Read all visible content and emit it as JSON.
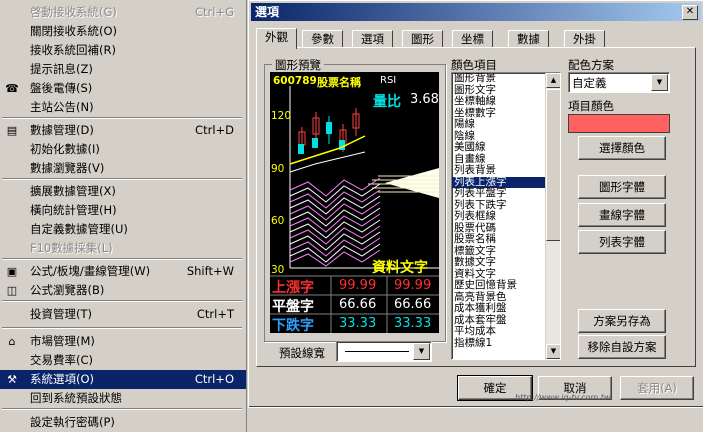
{
  "menu": {
    "items": [
      {
        "label": "啓動接收系統(G)",
        "shortcut": "Ctrl+G",
        "disabled": true,
        "icon": ""
      },
      {
        "label": "關閉接收系統(O)",
        "shortcut": "",
        "disabled": false,
        "icon": ""
      },
      {
        "label": "接收系統回補(R)",
        "shortcut": "",
        "disabled": false,
        "icon": ""
      },
      {
        "label": "提示訊息(Z)",
        "shortcut": "",
        "disabled": false,
        "icon": ""
      },
      {
        "label": "盤後電傳(S)",
        "shortcut": "",
        "disabled": false,
        "icon": "modem-icon"
      },
      {
        "label": "主站公告(N)",
        "shortcut": "",
        "disabled": false,
        "icon": ""
      },
      {
        "label": "數據管理(D)",
        "shortcut": "Ctrl+D",
        "disabled": false,
        "icon": "data-manager-icon"
      },
      {
        "label": "初始化數據(I)",
        "shortcut": "",
        "disabled": false,
        "icon": ""
      },
      {
        "label": "數據瀏覽器(V)",
        "shortcut": "",
        "disabled": false,
        "icon": ""
      },
      {
        "label": "擴展數據管理(X)",
        "shortcut": "",
        "disabled": false,
        "icon": ""
      },
      {
        "label": "橫向統計管理(H)",
        "shortcut": "",
        "disabled": false,
        "icon": ""
      },
      {
        "label": "自定義數據管理(U)",
        "shortcut": "",
        "disabled": false,
        "icon": ""
      },
      {
        "label": "F10數據採集(L)",
        "shortcut": "",
        "disabled": true,
        "icon": ""
      },
      {
        "label": "公式/板塊/畫線管理(W)",
        "shortcut": "Shift+W",
        "disabled": false,
        "icon": "formula-icon"
      },
      {
        "label": "公式瀏覽器(B)",
        "shortcut": "",
        "disabled": false,
        "icon": "browser-icon"
      },
      {
        "label": "投資管理(T)",
        "shortcut": "Ctrl+T",
        "disabled": false,
        "icon": ""
      },
      {
        "label": "市場管理(M)",
        "shortcut": "",
        "disabled": false,
        "icon": "home-icon"
      },
      {
        "label": "交易費率(C)",
        "shortcut": "",
        "disabled": false,
        "icon": ""
      },
      {
        "label": "系統選項(O)",
        "shortcut": "Ctrl+O",
        "disabled": false,
        "icon": "tools-icon",
        "selected": true
      },
      {
        "label": "回到系統預設狀態",
        "shortcut": "",
        "disabled": false,
        "icon": ""
      },
      {
        "label": "設定執行密碼(P)",
        "shortcut": "",
        "disabled": false,
        "icon": ""
      }
    ]
  },
  "dialog": {
    "title": "選項",
    "close_glyph": "✕",
    "tabs": [
      "外觀",
      "參數",
      "選項",
      "圖形",
      "坐標",
      "數據",
      "外掛"
    ],
    "active_tab": 0,
    "preview_group_label": "圖形預覽",
    "preview": {
      "code": "600789",
      "name": "股票名稱",
      "indicator": "RSI",
      "volume_ratio_label": "量比",
      "volume_ratio": "3.68",
      "y_ticks": [
        "120",
        "90",
        "60",
        "30"
      ],
      "data_text": "資料文字",
      "rows": [
        {
          "label": "上漲字",
          "v1": "99.99",
          "v2": "99.99",
          "label_color": "#ff3030",
          "value_color": "#ff3030"
        },
        {
          "label": "平盤字",
          "v1": "66.66",
          "v2": "66.66",
          "label_color": "#ffffff",
          "value_color": "#ffffff"
        },
        {
          "label": "下跌字",
          "v1": "33.33",
          "v2": "33.33",
          "label_color": "#30a0ff",
          "value_color": "#00e0e0"
        }
      ]
    },
    "color_items_label": "顏色項目",
    "color_items": [
      "圖形背景",
      "圖形文字",
      "坐標軸線",
      "坐標數字",
      "陽線",
      "陰線",
      "美國線",
      "自畫線",
      "列表背景",
      "列表上漲字",
      "列表平盤字",
      "列表下跌字",
      "列表框線",
      "股票代碼",
      "股票名稱",
      "標籤文字",
      "數據文字",
      "資料文字",
      "歷史回憶背景",
      "高亮背景色",
      "成本獲利盤",
      "成本套牢盤",
      "平均成本",
      "指標線1"
    ],
    "selected_color_item": 9,
    "scheme_label": "配色方案",
    "scheme_value": "自定義",
    "item_color_label": "項目顏色",
    "item_color": "#ff6060",
    "buttons": {
      "choose_color": "選擇顏色",
      "graph_font": "圖形字體",
      "drawing_font": "畫線字體",
      "list_font": "列表字體",
      "save_scheme": "方案另存為",
      "remove_scheme": "移除自設方案",
      "ok": "確定",
      "cancel": "取消",
      "apply": "套用(A)"
    },
    "line_width_label": "預設線寬",
    "watermark": "http://www.iq-tv.com.tw"
  },
  "colors": {
    "title_start": "#0a246a",
    "title_end": "#a6caf0",
    "selection": "#0a246a",
    "face": "#d4d0c8",
    "candle_red": "#ff4040",
    "candle_cyan": "#00e0e0",
    "yellow_text": "#ffff00"
  }
}
